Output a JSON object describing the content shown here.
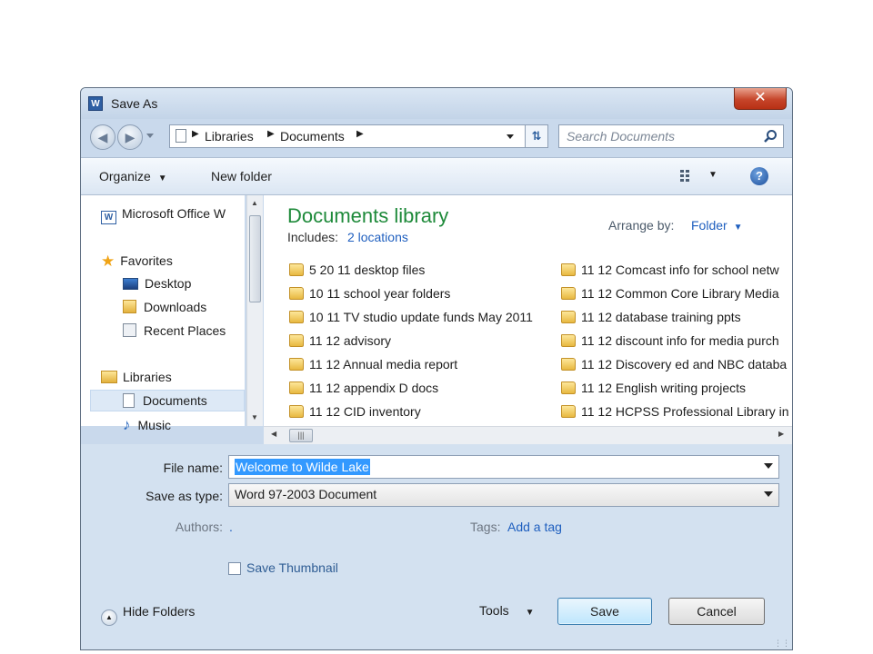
{
  "window": {
    "title": "Save As",
    "close_glyph": "✕"
  },
  "address": {
    "breadcrumb": [
      "Libraries",
      "Documents"
    ],
    "search_placeholder": "Search Documents"
  },
  "toolbar": {
    "organize": "Organize",
    "new_folder": "New folder"
  },
  "nav": {
    "items": [
      {
        "label": "Microsoft Office W",
        "icon": "word-icon"
      },
      {
        "label": "Favorites",
        "icon": "star-icon"
      },
      {
        "label": "Desktop",
        "icon": "desktop-icon"
      },
      {
        "label": "Downloads",
        "icon": "downloads-icon"
      },
      {
        "label": "Recent Places",
        "icon": "recent-places-icon"
      },
      {
        "label": "Libraries",
        "icon": "libraries-icon"
      },
      {
        "label": "Documents",
        "icon": "documents-icon",
        "selected": true
      },
      {
        "label": "Music",
        "icon": "music-icon"
      }
    ]
  },
  "content": {
    "library_title": "Documents library",
    "includes_label": "Includes:",
    "includes_link": "2 locations",
    "arrange_label": "Arrange by:",
    "arrange_value": "Folder",
    "files_col1": [
      "5 20 11 desktop files",
      "10 11 school year folders",
      "10 11 TV studio update funds May 2011",
      "11 12 advisory",
      "11 12 Annual media report",
      "11 12 appendix D docs",
      "11 12 CID inventory"
    ],
    "files_col2": [
      "11 12 Comcast info for school netw",
      "11 12 Common Core Library Media",
      "11 12 database training ppts",
      "11 12 discount info for media purch",
      "11 12 Discovery ed and NBC databa",
      "11 12 English writing projects",
      "11 12 HCPSS Professional Library in"
    ]
  },
  "form": {
    "file_name_label": "File name:",
    "file_name_value": "Welcome to Wilde Lake",
    "save_type_label": "Save as type:",
    "save_type_value": "Word 97-2003 Document",
    "authors_label": "Authors:",
    "authors_value": ".",
    "tags_label": "Tags:",
    "tags_value": "Add a tag",
    "thumbnail_label": "Save Thumbnail"
  },
  "footer": {
    "hide_folders": "Hide Folders",
    "tools": "Tools",
    "save": "Save",
    "cancel": "Cancel"
  },
  "colors": {
    "accent_green": "#1e8a3a",
    "link_blue": "#1f5fbf",
    "selection": "#3399ff"
  }
}
